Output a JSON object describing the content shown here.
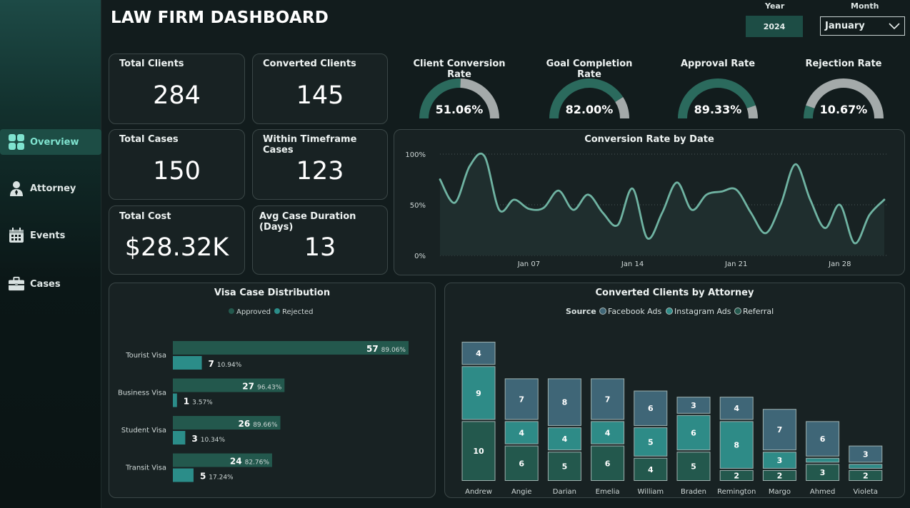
{
  "header": {
    "title": "LAW FIRM DASHBOARD"
  },
  "filters": {
    "year_label": "Year",
    "year_value": "2024",
    "month_label": "Month",
    "month_value": "January"
  },
  "sidebar": {
    "items": [
      {
        "label": "Overview",
        "icon": "grid-icon",
        "active": true
      },
      {
        "label": "Attorney",
        "icon": "person-icon",
        "active": false
      },
      {
        "label": "Events",
        "icon": "calendar-icon",
        "active": false
      },
      {
        "label": "Cases",
        "icon": "briefcase-icon",
        "active": false
      }
    ]
  },
  "kpis": {
    "total_clients": {
      "label": "Total Clients",
      "value": "284"
    },
    "converted_clients": {
      "label": "Converted Clients",
      "value": "145"
    },
    "total_cases": {
      "label": "Total Cases",
      "value": "150"
    },
    "within_timeframe": {
      "label": "Within Timeframe Cases",
      "value": "123"
    },
    "total_cost": {
      "label": "Total Cost",
      "value": "$28.32K"
    },
    "avg_duration": {
      "label": "Avg Case Duration (Days)",
      "value": "13"
    }
  },
  "gauges": [
    {
      "title": "Client Conversion Rate",
      "label": "51.06%",
      "value": 0.5106
    },
    {
      "title": "Goal Completion Rate",
      "label": "82.00%",
      "value": 0.82
    },
    {
      "title": "Approval Rate",
      "label": "89.33%",
      "value": 0.8933
    },
    {
      "title": "Rejection Rate",
      "label": "10.67%",
      "value": 0.1067
    }
  ],
  "colors": {
    "accent": "#2b6a5d",
    "teal": "#2e8b87",
    "gauge_track": "#a4aaaa",
    "line": "#6fb3a2",
    "slate": "#3f6677",
    "approved": "#23584d",
    "rejected": "#2b8d89"
  },
  "chart_data": [
    {
      "type": "line",
      "title": "Conversion Rate by Date",
      "x": [
        1,
        2,
        3,
        4,
        5,
        6,
        7,
        8,
        9,
        10,
        11,
        12,
        13,
        14,
        15,
        16,
        17,
        18,
        19,
        20,
        21,
        22,
        23,
        24,
        25,
        26,
        27,
        28,
        29,
        30,
        31
      ],
      "y": [
        75,
        52,
        88,
        98,
        45,
        55,
        46,
        47,
        64,
        45,
        60,
        42,
        30,
        66,
        17,
        42,
        72,
        45,
        60,
        63,
        65,
        42,
        22,
        50,
        90,
        55,
        27,
        50,
        12,
        40,
        55
      ],
      "xticks": [
        "Jan 07",
        "Jan 14",
        "Jan 21",
        "Jan 28"
      ],
      "xtick_days": [
        7,
        14,
        21,
        28
      ],
      "yticks": [
        "0%",
        "50%",
        "100%"
      ],
      "ylim": [
        0,
        100
      ],
      "grid": true
    },
    {
      "type": "bar",
      "title": "Visa Case Distribution",
      "legend": [
        "Approved",
        "Rejected"
      ],
      "categories": [
        "Tourist Visa",
        "Business Visa",
        "Student Visa",
        "Transit Visa"
      ],
      "series": [
        {
          "name": "Approved",
          "values": [
            57,
            27,
            26,
            24
          ],
          "labels": [
            "89.06%",
            "96.43%",
            "89.66%",
            "82.76%"
          ]
        },
        {
          "name": "Rejected",
          "values": [
            7,
            1,
            3,
            5
          ],
          "labels": [
            "10.94%",
            "3.57%",
            "10.34%",
            "17.24%"
          ]
        }
      ]
    },
    {
      "type": "bar",
      "title": "Converted Clients by Attorney",
      "legend_title": "Source",
      "legend": [
        "Facebook Ads",
        "Instagram Ads",
        "Referral"
      ],
      "categories": [
        "Andrew",
        "Angie",
        "Darian",
        "Emelia",
        "William",
        "Braden",
        "Remington",
        "Margo",
        "Ahmed",
        "Violeta"
      ],
      "series": [
        {
          "name": "Referral",
          "values": [
            10,
            6,
            5,
            6,
            4,
            5,
            2,
            2,
            3,
            2
          ]
        },
        {
          "name": "Instagram Ads",
          "values": [
            9,
            4,
            4,
            4,
            5,
            6,
            8,
            3,
            1,
            1
          ]
        },
        {
          "name": "Facebook Ads",
          "values": [
            4,
            7,
            8,
            7,
            6,
            3,
            4,
            7,
            6,
            3
          ]
        }
      ]
    }
  ]
}
